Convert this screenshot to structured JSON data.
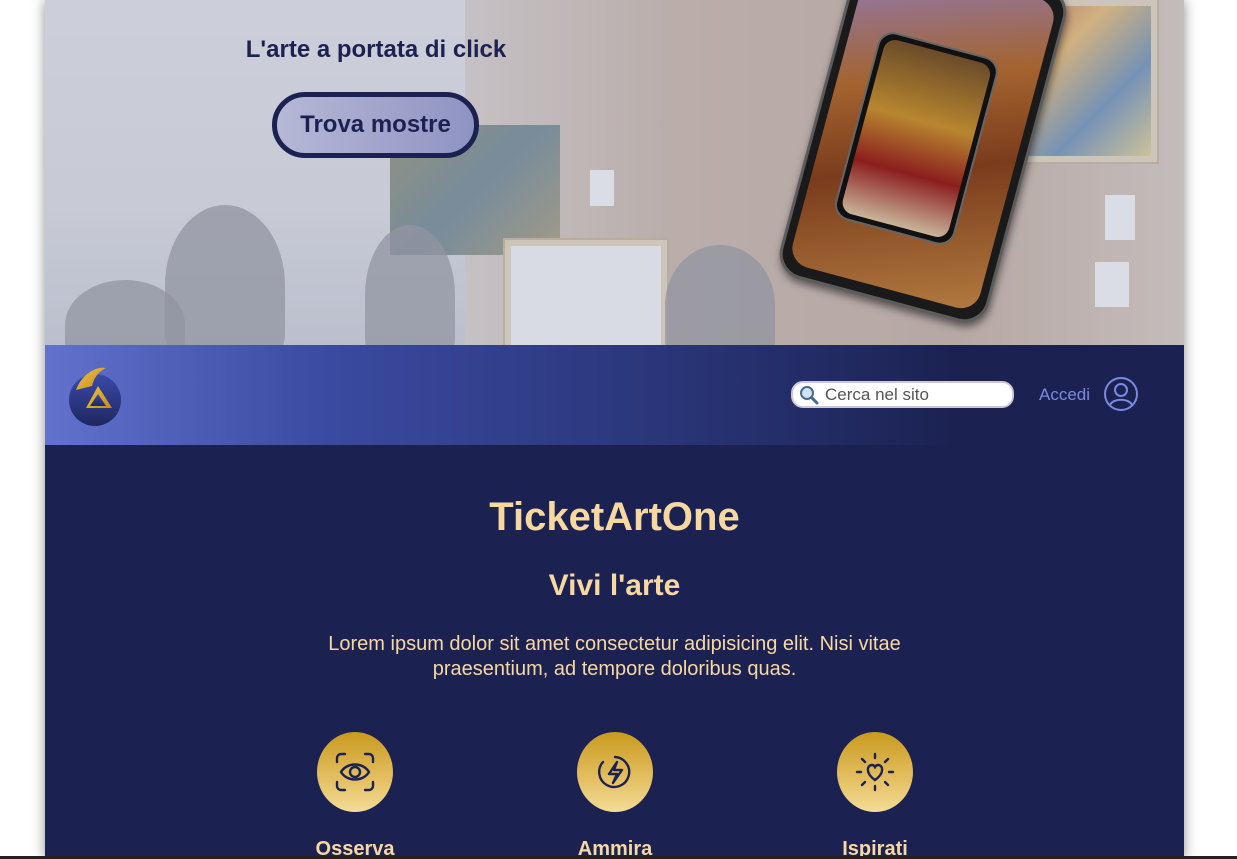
{
  "hero": {
    "title": "L'arte a portata di click",
    "cta_label": "Trova mostre"
  },
  "navbar": {
    "logo_icon": "ticketartone-logo-icon",
    "search": {
      "placeholder": "Cerca nel sito",
      "value": ""
    },
    "login_label": "Accedi",
    "user_icon": "user-circle-icon"
  },
  "main": {
    "brand": "TicketArtOne",
    "tagline": "Vivi l'arte",
    "intro": "Lorem ipsum dolor sit amet consectetur adipisicing elit. Nisi vitae praesentium, ad tempore doloribus quas.",
    "features": [
      {
        "label": "Osserva",
        "icon": "eye-scan-icon"
      },
      {
        "label": "Ammira",
        "icon": "lightning-circle-icon"
      },
      {
        "label": "Ispirati",
        "icon": "heart-sun-icon"
      }
    ]
  },
  "colors": {
    "navy": "#1b2252",
    "gold_text": "#f6d8a0",
    "nav_link": "#7c89e0",
    "gold_icon": "#e4c064"
  }
}
